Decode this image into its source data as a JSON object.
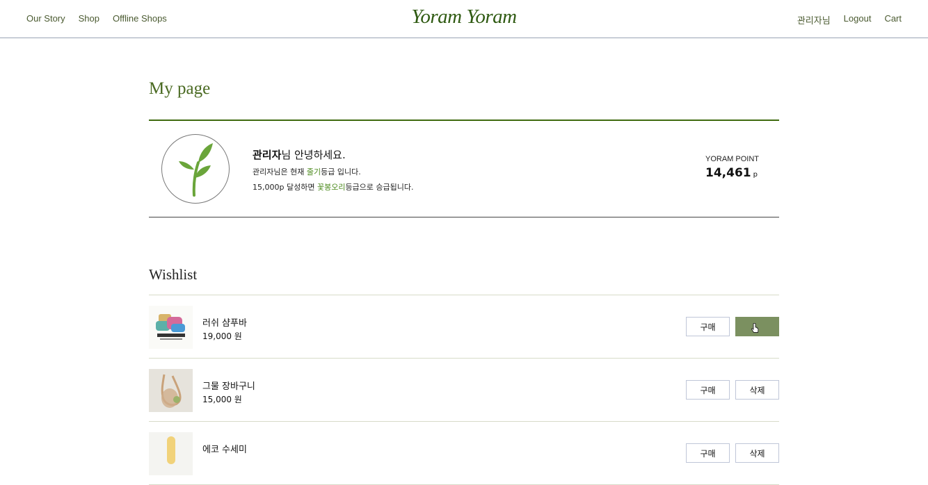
{
  "nav": {
    "left": [
      "Our Story",
      "Shop",
      "Offline Shops"
    ],
    "brand": "Yoram Yoram",
    "right": [
      "관리자님",
      "Logout",
      "Cart"
    ]
  },
  "page": {
    "title": "My page"
  },
  "profile": {
    "name": "관리자",
    "greeting_suffix": "님 안녕하세요.",
    "line1_prefix": "관리자님은 현재 ",
    "current_grade": "줄기",
    "line1_suffix": "등급 입니다.",
    "line2_prefix": "15,000p 달성하면 ",
    "next_grade": "꽃봉오리",
    "line2_suffix": "등급으로 승급됩니다.",
    "point_label": "YORAM POINT",
    "point_value": "14,461",
    "point_unit": "p"
  },
  "wishlist": {
    "title": "Wishlist",
    "items": [
      {
        "name": "러쉬 샴푸바",
        "price": "19,000 원",
        "buy": "구매",
        "delete": ""
      },
      {
        "name": "그물 장바구니",
        "price": "15,000 원",
        "buy": "구매",
        "delete": "삭제"
      },
      {
        "name": "에코 수세미",
        "price": "",
        "buy": "구매",
        "delete": "삭제"
      }
    ]
  },
  "colors": {
    "accent": "#3f6a0e",
    "brand": "#2f5a12",
    "hover_button": "#7b9060",
    "grade": "#4b8a1c"
  },
  "icons": {
    "avatar": "sprout-icon",
    "cursor": "pointer-cursor-icon"
  }
}
